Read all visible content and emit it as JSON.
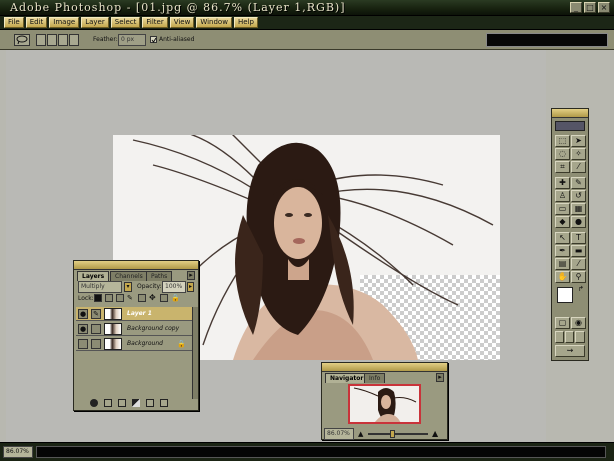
{
  "window": {
    "title": "Adobe Photoshop - [01.jpg @ 86.7% (Layer 1,RGB)]"
  },
  "menubar": {
    "items": [
      {
        "label": "File"
      },
      {
        "label": "Edit"
      },
      {
        "label": "Image"
      },
      {
        "label": "Layer"
      },
      {
        "label": "Select"
      },
      {
        "label": "Filter"
      },
      {
        "label": "View"
      },
      {
        "label": "Window"
      },
      {
        "label": "Help"
      }
    ]
  },
  "options": {
    "feather_label": "Feather:",
    "feather_value": "0 px",
    "antialiased_label": "Anti-aliased"
  },
  "layers_panel": {
    "tabs": [
      "Layers",
      "Channels",
      "Paths"
    ],
    "blend_mode": "Multiply",
    "opacity_label": "Opacity:",
    "opacity_value": "100%",
    "lock_label": "Lock:",
    "layers": [
      {
        "name": "Layer 1",
        "selected": true,
        "visible": true
      },
      {
        "name": "Background copy",
        "selected": false,
        "visible": true
      },
      {
        "name": "Background",
        "selected": false,
        "visible": false,
        "locked": true
      }
    ]
  },
  "navigator_panel": {
    "tabs": [
      "Navigator",
      "Info"
    ],
    "zoom_value": "86.07%"
  },
  "statusbar": {
    "zoom_value": "86.07%"
  },
  "colors": {
    "titlebar": "#17210f",
    "menu_gold": "#c4a84e",
    "panel_body": "#9a9a80",
    "workspace": "#b9b9b5",
    "selection": "#c9b46d"
  }
}
